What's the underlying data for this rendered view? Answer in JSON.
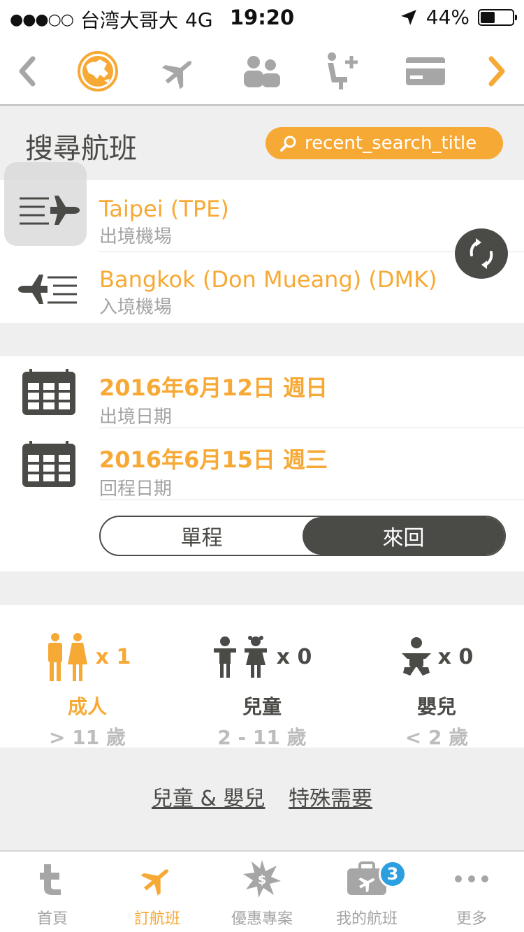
{
  "status_bar": {
    "carrier": "台湾大哥大",
    "network": "4G",
    "time": "19:20",
    "battery": "44%"
  },
  "step_nav": {
    "icons": [
      "chevron-left-icon",
      "globe-icon",
      "plane-icon",
      "people-icon",
      "seat-add-icon",
      "card-icon",
      "chevron-right-icon"
    ],
    "active_index": 1
  },
  "header": {
    "title": "搜尋航班",
    "recent_search_label": "recent_search_title"
  },
  "route": {
    "origin": {
      "name": "Taipei (TPE)",
      "label": "出境機場"
    },
    "destination": {
      "name": "Bangkok (Don Mueang) (DMK)",
      "label": "入境機場"
    }
  },
  "dates": {
    "depart": {
      "value": "2016年6月12日 週日",
      "label": "出境日期"
    },
    "return": {
      "value": "2016年6月15日 週三",
      "label": "回程日期"
    }
  },
  "trip_type": {
    "one_way": "單程",
    "round_trip": "來回",
    "selected": "round_trip"
  },
  "passengers": {
    "adult": {
      "count": "x 1",
      "label": "成人",
      "age": "> 11 歲"
    },
    "child": {
      "count": "x 0",
      "label": "兒童",
      "age": "2 - 11 歲"
    },
    "infant": {
      "count": "x 0",
      "label": "嬰兒",
      "age": "< 2 歲"
    }
  },
  "links": {
    "children_infants": "兒童 & 嬰兒",
    "special_needs": "特殊需要"
  },
  "tab_bar": {
    "home": "首頁",
    "book": "訂航班",
    "deals": "優惠專案",
    "my_flights": "我的航班",
    "my_flights_badge": "3",
    "more": "更多"
  },
  "colors": {
    "accent": "#f7a935",
    "dark": "#4a4a47",
    "muted": "#a4a4a4",
    "badge": "#2b9fe0"
  }
}
